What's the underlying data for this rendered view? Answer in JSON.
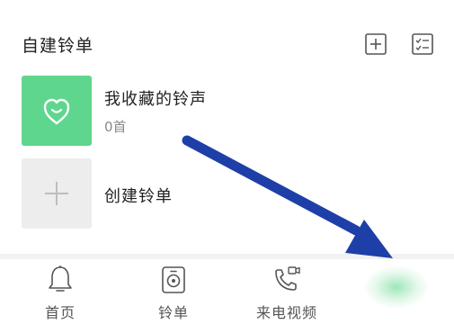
{
  "section": {
    "title": "自建铃单"
  },
  "playlists": [
    {
      "title": "我收藏的铃声",
      "count": "0首"
    },
    {
      "title": "创建铃单"
    }
  ],
  "tabs": [
    {
      "label": "首页",
      "icon": "bell-icon"
    },
    {
      "label": "铃单",
      "icon": "speaker-icon"
    },
    {
      "label": "来电视频",
      "icon": "phone-video-icon"
    },
    {
      "label": "",
      "icon": "active-tab-indicator"
    }
  ],
  "colors": {
    "accent": "#5fd68e",
    "placeholder_bg": "#ededed",
    "arrow": "#1f3fa8"
  }
}
